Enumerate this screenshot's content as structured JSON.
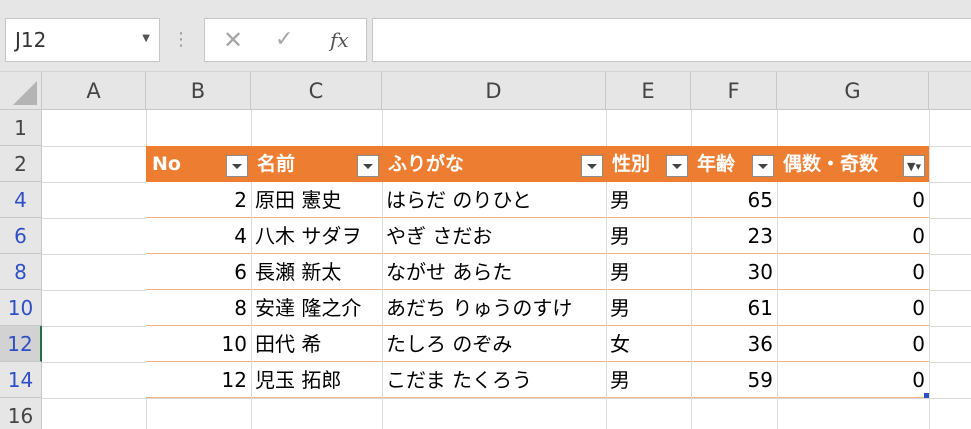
{
  "formula_bar": {
    "name_box": "J12",
    "cancel_icon": "✕",
    "enter_icon": "✓",
    "fx_label": "fx",
    "formula": ""
  },
  "columns": [
    "A",
    "B",
    "C",
    "D",
    "E",
    "F",
    "G"
  ],
  "rows": [
    {
      "label": "1",
      "filtered": false
    },
    {
      "label": "2",
      "filtered": false
    },
    {
      "label": "4",
      "filtered": true
    },
    {
      "label": "6",
      "filtered": true
    },
    {
      "label": "8",
      "filtered": true
    },
    {
      "label": "10",
      "filtered": true
    },
    {
      "label": "12",
      "filtered": true,
      "active": true
    },
    {
      "label": "14",
      "filtered": true
    },
    {
      "label": "16",
      "filtered": false
    }
  ],
  "table": {
    "headers": [
      "No",
      "名前",
      "ふりがな",
      "性別",
      "年齢",
      "偶数・奇数"
    ],
    "filtered_column": "偶数・奇数",
    "records": [
      {
        "no": "2",
        "name": "原田 憲史",
        "kana": "はらだ のりひと",
        "gender": "男",
        "age": "65",
        "parity": "0"
      },
      {
        "no": "4",
        "name": "八木 サダヲ",
        "kana": "やぎ さだお",
        "gender": "男",
        "age": "23",
        "parity": "0"
      },
      {
        "no": "6",
        "name": "長瀬 新太",
        "kana": "ながせ あらた",
        "gender": "男",
        "age": "30",
        "parity": "0"
      },
      {
        "no": "8",
        "name": "安達 隆之介",
        "kana": "あだち りゅうのすけ",
        "gender": "男",
        "age": "61",
        "parity": "0"
      },
      {
        "no": "10",
        "name": "田代 希",
        "kana": "たしろ のぞみ",
        "gender": "女",
        "age": "36",
        "parity": "0"
      },
      {
        "no": "12",
        "name": "児玉 拓郎",
        "kana": "こだま たくろう",
        "gender": "男",
        "age": "59",
        "parity": "0"
      }
    ]
  },
  "colors": {
    "header_fill": "#ed7d31",
    "row_border": "#f4b183",
    "filtered_row_number": "#2f4fc5"
  }
}
